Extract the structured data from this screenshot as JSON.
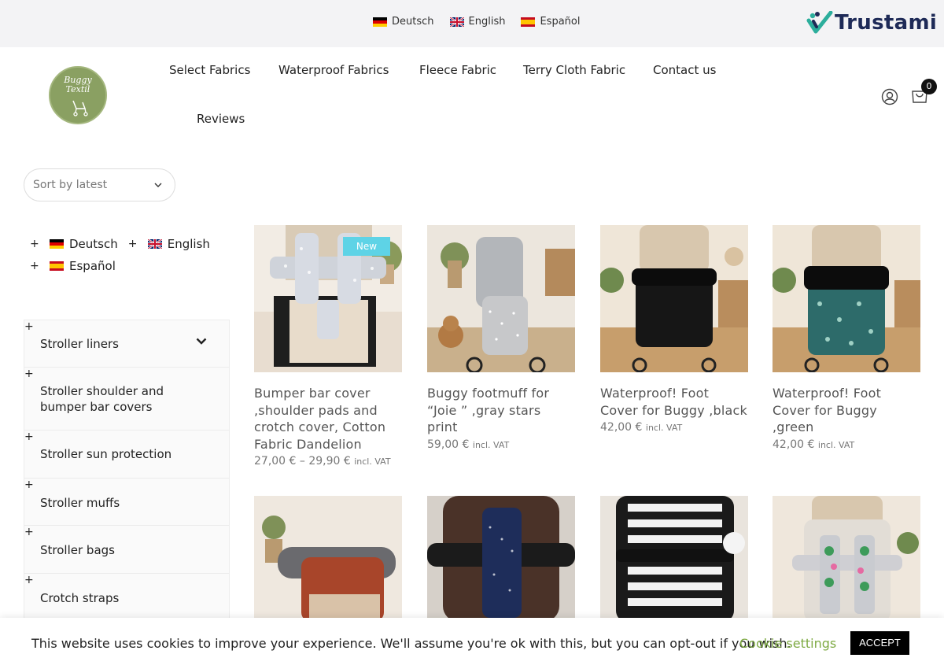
{
  "topbar": {
    "languages": [
      {
        "label": "Deutsch",
        "flag": "germany-flag-icon"
      },
      {
        "label": "English",
        "flag": "uk-flag-icon"
      },
      {
        "label": "Español",
        "flag": "spain-flag-icon"
      }
    ],
    "trust_badge": {
      "text": "Trustami",
      "icon": "trustami-logo-icon",
      "accent": "#2cae9c",
      "color": "#1e2a57"
    }
  },
  "header": {
    "logo_text_1": "Buggy",
    "logo_text_2": "Textil",
    "logo_color": "#8aa062",
    "nav": [
      "Select Fabrics",
      "Waterproof Fabrics",
      "Fleece Fabric",
      "Terry Cloth Fabric",
      "Contact us",
      "Reviews"
    ],
    "cart_count": "0"
  },
  "sort": {
    "label": "Sort by latest"
  },
  "sidebar": {
    "languages": [
      "Deutsch",
      "English",
      "Español"
    ],
    "plus": "+",
    "categories": [
      "Stroller liners",
      "Stroller shoulder and bumper bar covers",
      "Stroller sun protection",
      "Stroller muffs",
      "Stroller bags",
      "Crotch straps"
    ]
  },
  "products": [
    {
      "title": "Bumper bar cover ,shoulder pads and crotch cover, Cotton Fabric Dandelion",
      "price": "27,00 € – 29,90 €",
      "vat": "incl. VAT",
      "badge": "New"
    },
    {
      "title": "Buggy footmuff for “Joie ” ,gray stars print",
      "price": "59,00 €",
      "vat": "incl. VAT"
    },
    {
      "title": "Waterproof! Foot Cover for Buggy ,black",
      "price": "42,00 €",
      "vat": "incl. VAT"
    },
    {
      "title": "Waterproof! Foot Cover for Buggy ,green",
      "price": "42,00 €",
      "vat": "incl. VAT"
    }
  ],
  "cookie": {
    "text": "This website uses cookies to improve your experience. We'll assume you're ok with this, but you can opt-out if you wish.",
    "settings": "Cookie settings",
    "accept": "ACCEPT",
    "accent": "#7eaa43"
  }
}
